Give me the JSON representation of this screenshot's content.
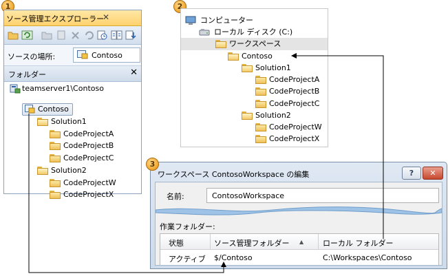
{
  "badges": [
    "1",
    "2",
    "3"
  ],
  "explorer": {
    "title": "ソース管理エクスプローラー",
    "close_glyph": "✕",
    "source_location_label": "ソースの場所:",
    "source_location_value": "Contoso",
    "folders_header": "フォルダー",
    "folders_close_glyph": "✕",
    "server": "teamserver1\\Contoso",
    "selected_item": "Contoso",
    "tree": [
      {
        "label": "Solution1",
        "level": 1,
        "open": true
      },
      {
        "label": "CodeProjectA",
        "level": 2
      },
      {
        "label": "CodeProjectB",
        "level": 2
      },
      {
        "label": "CodeProjectC",
        "level": 2
      },
      {
        "label": "Solution2",
        "level": 1,
        "open": true
      },
      {
        "label": "CodeProjectW",
        "level": 2
      },
      {
        "label": "CodeProjectX",
        "level": 2
      }
    ]
  },
  "local_tree": {
    "computer": "コンピューター",
    "disk": "ローカル ディスク (C:)",
    "workspaces": "ワークスペース",
    "contoso": "Contoso",
    "items": [
      {
        "label": "Solution1",
        "level": 3
      },
      {
        "label": "CodeProjectA",
        "level": 4
      },
      {
        "label": "CodeProjectB",
        "level": 4
      },
      {
        "label": "CodeProjectC",
        "level": 4
      },
      {
        "label": "Solution2",
        "level": 3
      },
      {
        "label": "CodeProjectW",
        "level": 4
      },
      {
        "label": "CodeProjectX",
        "level": 4
      }
    ]
  },
  "dialog": {
    "title": "ワークスペース ContosoWorkspace の編集",
    "help_button": "?",
    "close_button": "✕",
    "name_label": "名前:",
    "name_value": "ContosoWorkspace",
    "working_folders_label": "作業フォルダー:",
    "columns": [
      "状態",
      "ソース管理フォルダー",
      "ローカル フォルダー"
    ],
    "sort_glyph": "▲",
    "row": {
      "status": "アクティブ",
      "source": "$/Contoso",
      "local": "C:\\Workspaces\\Contoso"
    }
  }
}
